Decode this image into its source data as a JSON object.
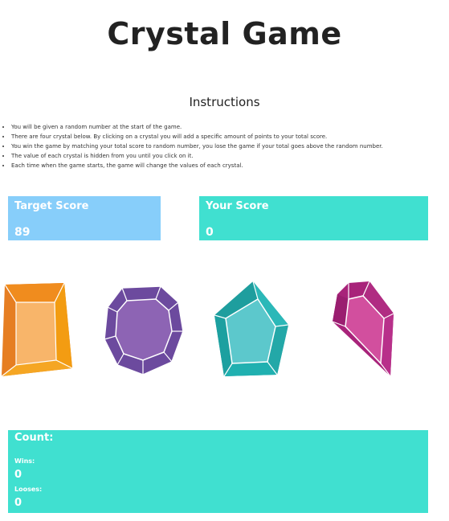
{
  "title": "Crystal Game",
  "instructions": {
    "heading": "Instructions",
    "items": [
      "You will be given a random number at the start of the game.",
      "There are four crystal below. By clicking on a crystal you will add a specific amount of points to your total score.",
      "You win the game by matching your total score to random number, you lose the game if your total goes above the random number.",
      "The value of each crystal is hidden from you until you click on it.",
      "Each time when the game starts, the game will change the values of each crystal."
    ]
  },
  "target": {
    "label": "Target Score",
    "value": "89"
  },
  "score": {
    "label": "Your Score",
    "value": "0"
  },
  "crystals": [
    {
      "icon": "orange-crystal-icon",
      "color": "#F0A030"
    },
    {
      "icon": "purple-crystal-icon",
      "color": "#8A5FB0"
    },
    {
      "icon": "teal-crystal-icon",
      "color": "#28B4B4"
    },
    {
      "icon": "pink-crystal-icon",
      "color": "#C83C96"
    }
  ],
  "count": {
    "label": "Count:",
    "wins_label": "Wins:",
    "wins": "0",
    "losses_label": "Looses:",
    "losses": "0"
  },
  "colors": {
    "target_panel": "#87CEFA",
    "score_panel": "#40E0D0",
    "count_panel": "#40E0D0"
  }
}
